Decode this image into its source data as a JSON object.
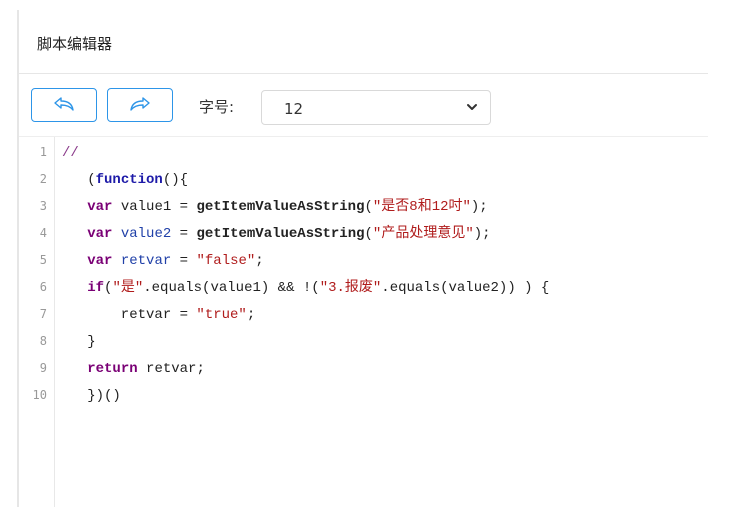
{
  "title": "脚本编辑器",
  "toolbar": {
    "undo_icon": "undo-icon",
    "redo_icon": "redo-icon",
    "font_label": "字号:",
    "font_size": "12",
    "accent_color": "#2d95e8"
  },
  "editor": {
    "line_numbers": [
      "1",
      "2",
      "3",
      "4",
      "5",
      "6",
      "7",
      "8",
      "9",
      "10"
    ],
    "lines": [
      [
        "//"
      ],
      [
        "   (",
        "function",
        "(){"
      ],
      [
        "   ",
        "var",
        " value1 = ",
        "getItemValueAsString",
        "(",
        "\"是否8和12吋\"",
        ");"
      ],
      [
        "   ",
        "var",
        " ",
        "value2",
        " = ",
        "getItemValueAsString",
        "(",
        "\"产品处理意见\"",
        ");"
      ],
      [
        "   ",
        "var",
        " ",
        "retvar",
        " = ",
        "\"false\"",
        ";"
      ],
      [
        "   ",
        "if",
        "(",
        "\"是\"",
        ".equals(value1) && !(",
        "\"3.报废\"",
        ".equals(value2)) ) {"
      ],
      [
        "       retvar = ",
        "\"true\"",
        ";"
      ],
      [
        "   }"
      ],
      [
        "   ",
        "return",
        " retvar;"
      ],
      [
        "   })()"
      ]
    ]
  }
}
